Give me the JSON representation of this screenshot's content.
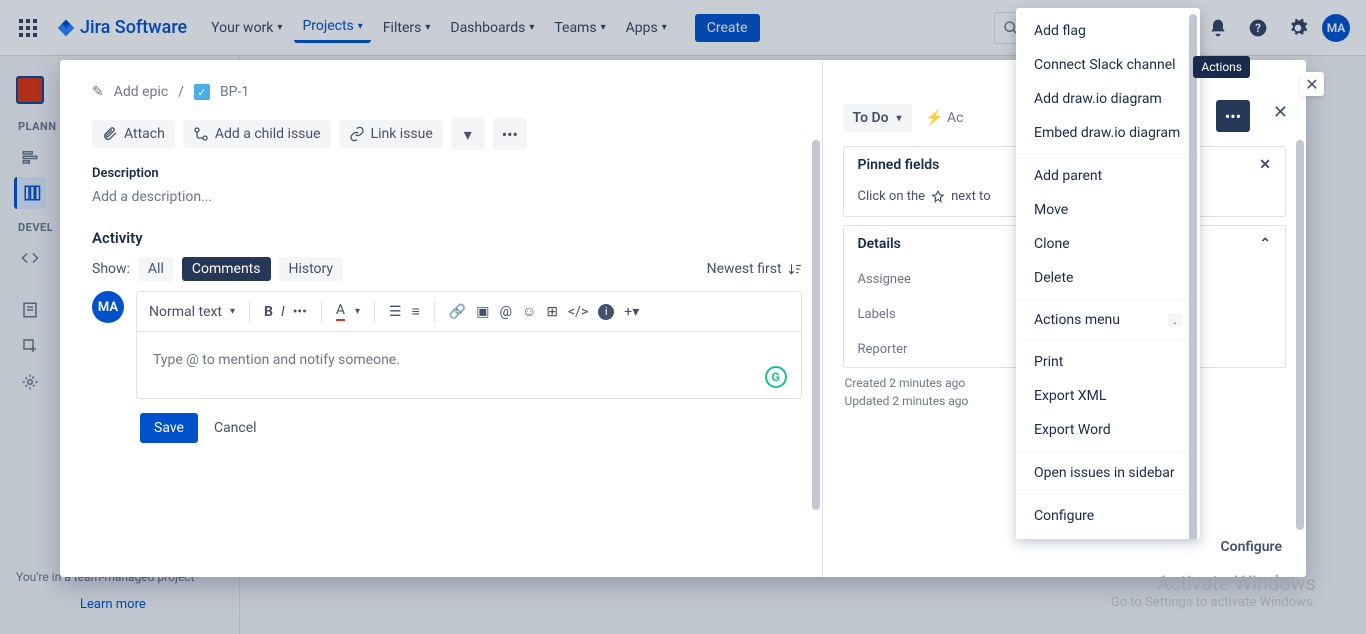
{
  "topnav": {
    "logo": "Jira Software",
    "items": [
      "Your work",
      "Projects",
      "Filters",
      "Dashboards",
      "Teams",
      "Apps"
    ],
    "active_index": 1,
    "create": "Create",
    "avatar": "MA"
  },
  "sidebar": {
    "labels": [
      "PLANN",
      "DEVEL"
    ],
    "team_managed": "You're in a team-managed project",
    "learn_more": "Learn more"
  },
  "breadcrumb": {
    "add_epic": "Add epic",
    "issue_key": "BP-1"
  },
  "toolbar": {
    "attach": "Attach",
    "add_child": "Add a child issue",
    "link_issue": "Link issue"
  },
  "description": {
    "title": "Description",
    "placeholder": "Add a description..."
  },
  "activity": {
    "title": "Activity",
    "show_label": "Show:",
    "filters": [
      "All",
      "Comments",
      "History"
    ],
    "newest": "Newest first"
  },
  "editor": {
    "style": "Normal text",
    "placeholder": "Type @ to mention and notify someone.",
    "save": "Save",
    "cancel": "Cancel"
  },
  "right": {
    "status": "To Do",
    "actions_cut": "Ac",
    "pinned_title": "Pinned fields",
    "pinned_hint_a": "Click on the",
    "pinned_hint_b": "next to",
    "details_title": "Details",
    "fields": [
      "Assignee",
      "Labels",
      "Reporter"
    ],
    "created": "Created 2 minutes ago",
    "updated": "Updated 2 minutes ago",
    "configure": "Configure"
  },
  "dropdown": {
    "items_top": [
      "Add flag",
      "Connect Slack channel",
      "Add draw.io diagram",
      "Embed draw.io diagram"
    ],
    "items_mid": [
      "Add parent",
      "Move",
      "Clone",
      "Delete"
    ],
    "actions_menu": "Actions menu",
    "items_bot": [
      "Print",
      "Export XML",
      "Export Word"
    ],
    "open_sidebar": "Open issues in sidebar",
    "configure": "Configure"
  },
  "tooltip": "Actions",
  "windows": {
    "line1": "Activate Windows",
    "line2": "Go to Settings to activate Windows."
  }
}
